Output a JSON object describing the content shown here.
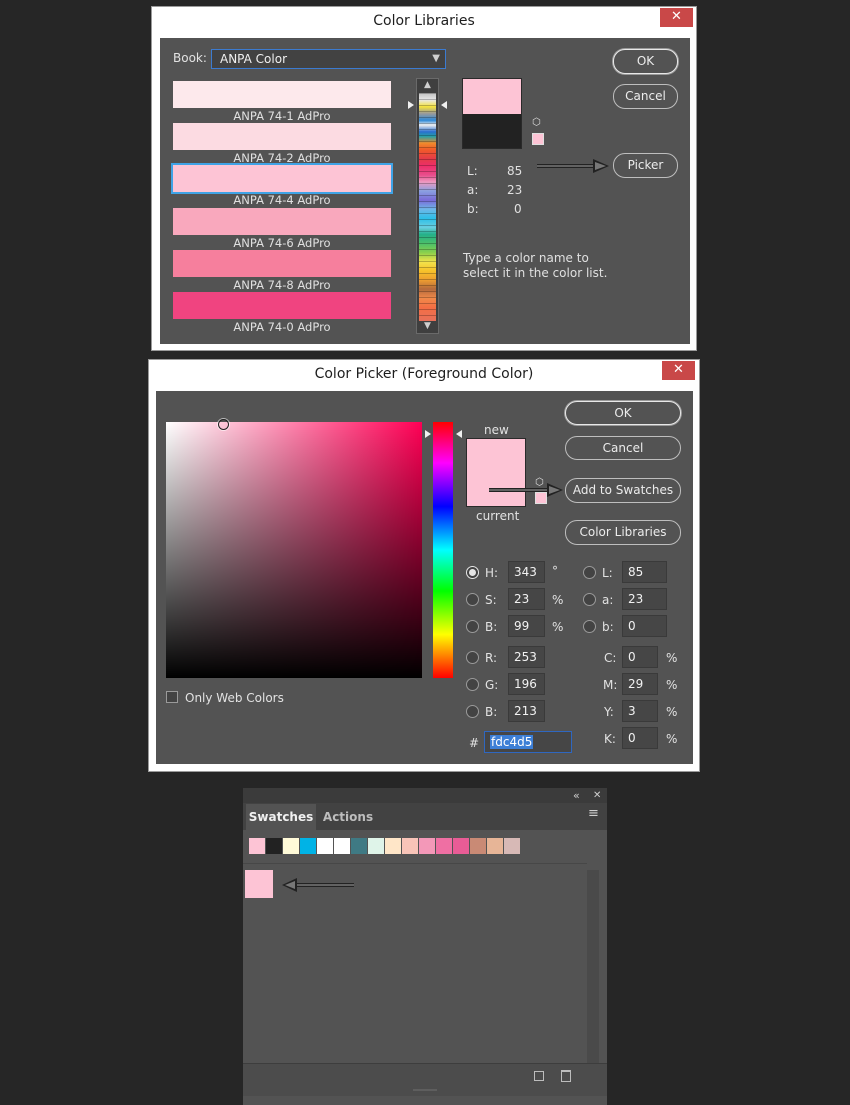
{
  "color_libraries": {
    "title": "Color Libraries",
    "close_glyph": "✕",
    "book_label": "Book:",
    "book_value": "ANPA Color",
    "items": [
      {
        "name": "ANPA 74-1 AdPro",
        "color": "#fde9ec"
      },
      {
        "name": "ANPA 74-2 AdPro",
        "color": "#fcdbe2"
      },
      {
        "name": "ANPA 74-4 AdPro",
        "color": "#fdc4d5",
        "selected": true
      },
      {
        "name": "ANPA 74-6 AdPro",
        "color": "#f9a8bd"
      },
      {
        "name": "ANPA 74-8 AdPro",
        "color": "#f67f9d"
      },
      {
        "name": "ANPA 74-0 AdPro",
        "color": "#f04480"
      }
    ],
    "lab": {
      "l_label": "L:",
      "l": "85",
      "a_label": "a:",
      "a": "23",
      "b_label": "b:",
      "b": "0"
    },
    "hint": "Type a color name to select it in the color list.",
    "buttons": {
      "ok": "OK",
      "cancel": "Cancel",
      "picker": "Picker"
    },
    "preview": {
      "new_color": "#fdc4d5",
      "current_color": "#222222"
    }
  },
  "color_picker": {
    "title": "Color Picker (Foreground Color)",
    "close_glyph": "✕",
    "new_label": "new",
    "current_label": "current",
    "new_color": "#fdc4d5",
    "current_color": "#fdc4d5",
    "hue_color": "#ff0055",
    "buttons": {
      "ok": "OK",
      "cancel": "Cancel",
      "add_to_swatches": "Add to Swatches",
      "color_libraries": "Color Libraries"
    },
    "only_web_colors": "Only Web Colors",
    "hsb": {
      "h_label": "H:",
      "h": "343",
      "h_unit": "°",
      "s_label": "S:",
      "s": "23",
      "s_unit": "%",
      "b_label": "B:",
      "b": "99",
      "b_unit": "%"
    },
    "rgb": {
      "r_label": "R:",
      "r": "253",
      "g_label": "G:",
      "g": "196",
      "b_label": "B:",
      "b": "213"
    },
    "lab": {
      "l_label": "L:",
      "l": "85",
      "a_label": "a:",
      "a": "23",
      "b_label": "b:",
      "b": "0"
    },
    "cmyk": {
      "c_label": "C:",
      "c": "0",
      "m_label": "M:",
      "m": "29",
      "y_label": "Y:",
      "y": "3",
      "k_label": "K:",
      "k": "0",
      "unit": "%"
    },
    "hex_label": "#",
    "hex": "fdc4d5"
  },
  "swatches_panel": {
    "collapse_glyph": "«",
    "close_glyph": "✕",
    "tabs": [
      "Swatches",
      "Actions"
    ],
    "menu_glyph": "≡",
    "swatch_colors": [
      "#fdc4d5",
      "#222222",
      "#fffad8",
      "#00b3e6",
      "#ffffff",
      "#ffffff",
      "#3f7a84",
      "#dff4e9",
      "#ffe6c8",
      "#f8c4b8",
      "#f398b8",
      "#ef6fa3",
      "#e95c96",
      "#c98a75",
      "#e7b597",
      "#d7b9b6"
    ],
    "new_swatch_color": "#fdc4d5"
  }
}
